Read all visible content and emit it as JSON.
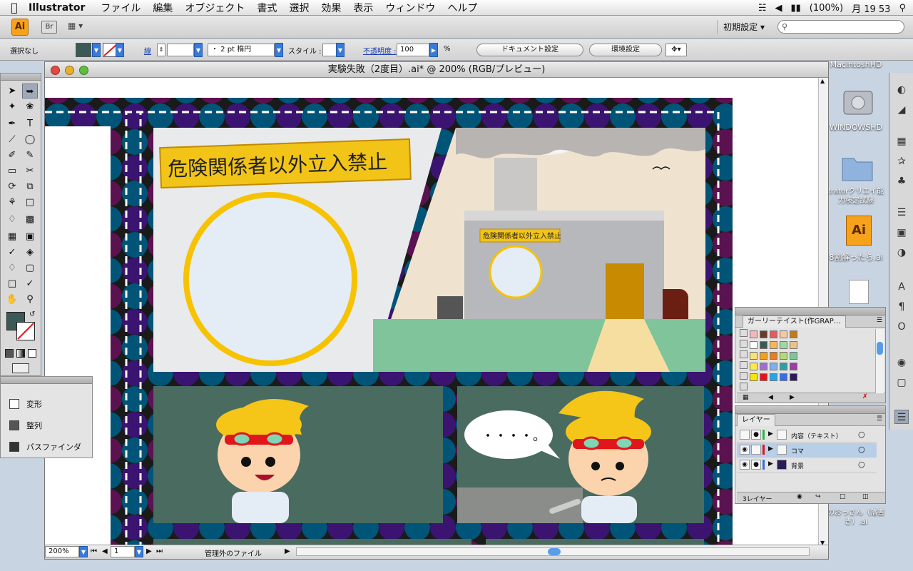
{
  "menubar": {
    "apple": "",
    "app": "Illustrator",
    "items": [
      "ファイル",
      "編集",
      "オブジェクト",
      "書式",
      "選択",
      "効果",
      "表示",
      "ウィンドウ",
      "ヘルプ"
    ],
    "battery": "(100%)",
    "clock": "月 19 53"
  },
  "appbar": {
    "ai_label": "Ai",
    "br_label": "Br",
    "workspace": "初期設定 ▾",
    "search_placeholder": ""
  },
  "controlbar": {
    "selection_label": "選択なし",
    "stroke_label": "線",
    "stroke_profile": "・ 2 pt 楕円",
    "style_label": "スタイル :",
    "opacity_label": "不透明度 :",
    "opacity_value": "100",
    "percent": "%",
    "doc_settings": "ドキュメント設定",
    "env_settings": "環境設定"
  },
  "document": {
    "title": "実験失敗（2度目）.ai* @ 200% (RGB/プレビュー)",
    "zoom": "200%",
    "page": "1",
    "status_text": "管理外のファイル"
  },
  "artwork": {
    "sign_big": "危険関係者以外立入禁止",
    "sign_small": "危険関係者以外立入禁止",
    "speech": "・・・・。"
  },
  "transform_panel": {
    "items": [
      "変形",
      "整列",
      "パスファインダ"
    ]
  },
  "swatches_panel": {
    "tab": "ガーリーテイスト(作GRAP…"
  },
  "layers_panel": {
    "tab": "レイヤー",
    "layers": [
      "内容（テキスト）",
      "コマ",
      "背景"
    ],
    "footer": "3レイヤー"
  },
  "desktop": {
    "items": [
      "MacintoshHD",
      "WINDOWSHD",
      "tratorクリエイ能力検定試験",
      "8割解ったら.ai",
      "のおっさん（落書き）.ai"
    ]
  },
  "colors": {
    "fill": "#3c5a55",
    "panel_green": "#4a6b60",
    "sign_yellow": "#f2c418",
    "ring_yellow": "#f7c300"
  }
}
